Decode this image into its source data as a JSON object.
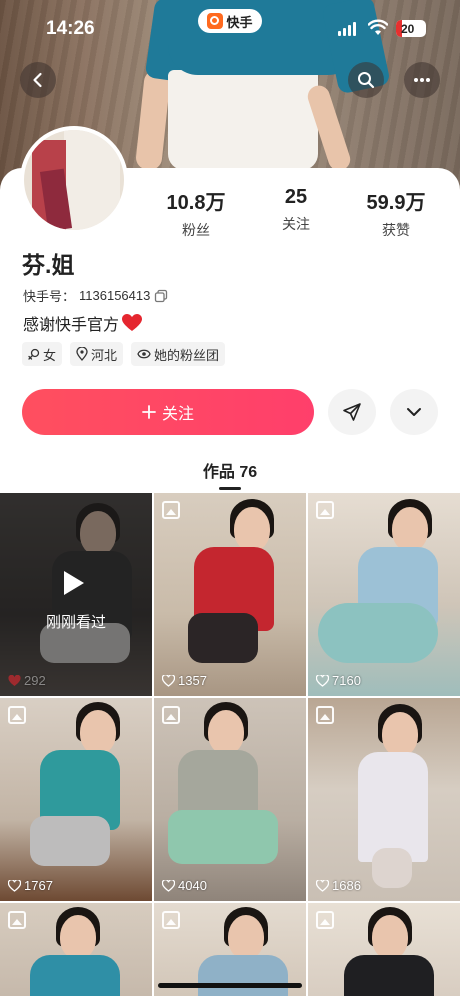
{
  "status_bar": {
    "time": "14:26",
    "app_name": "快手",
    "battery": "20",
    "battery_level": 0.2,
    "battery_color": "#e6302f"
  },
  "nav": {
    "back_icon": "chevron-left-icon",
    "search_icon": "search-icon",
    "more_icon": "more-dots-icon"
  },
  "profile": {
    "name": "芬.姐",
    "kuaishou_id_label": "快手号：",
    "kuaishou_id": "1136156413",
    "bio": "感谢快手官方",
    "tags": [
      {
        "icon": "gender-female-icon",
        "label": "女"
      },
      {
        "icon": "location-pin-icon",
        "label": "河北"
      },
      {
        "icon": "fan-group-icon",
        "label": "她的粉丝团"
      }
    ]
  },
  "stats": [
    {
      "value": "10.8万",
      "label": "粉丝"
    },
    {
      "value": "25",
      "label": "关注"
    },
    {
      "value": "59.9万",
      "label": "获赞"
    }
  ],
  "actions": {
    "follow_label": "关注",
    "accent_color": "#ff4566"
  },
  "works": {
    "tab_label": "作品 76",
    "items": [
      {
        "likes": "292",
        "overlay_label": "刚刚看过",
        "watched": true,
        "type": "video"
      },
      {
        "likes": "1357",
        "type": "image"
      },
      {
        "likes": "7160",
        "type": "image"
      },
      {
        "likes": "1767",
        "type": "image"
      },
      {
        "likes": "4040",
        "type": "image"
      },
      {
        "likes": "1686",
        "type": "image"
      },
      {
        "likes": "",
        "type": "image"
      },
      {
        "likes": "",
        "type": "image"
      },
      {
        "likes": "",
        "type": "image"
      }
    ]
  }
}
